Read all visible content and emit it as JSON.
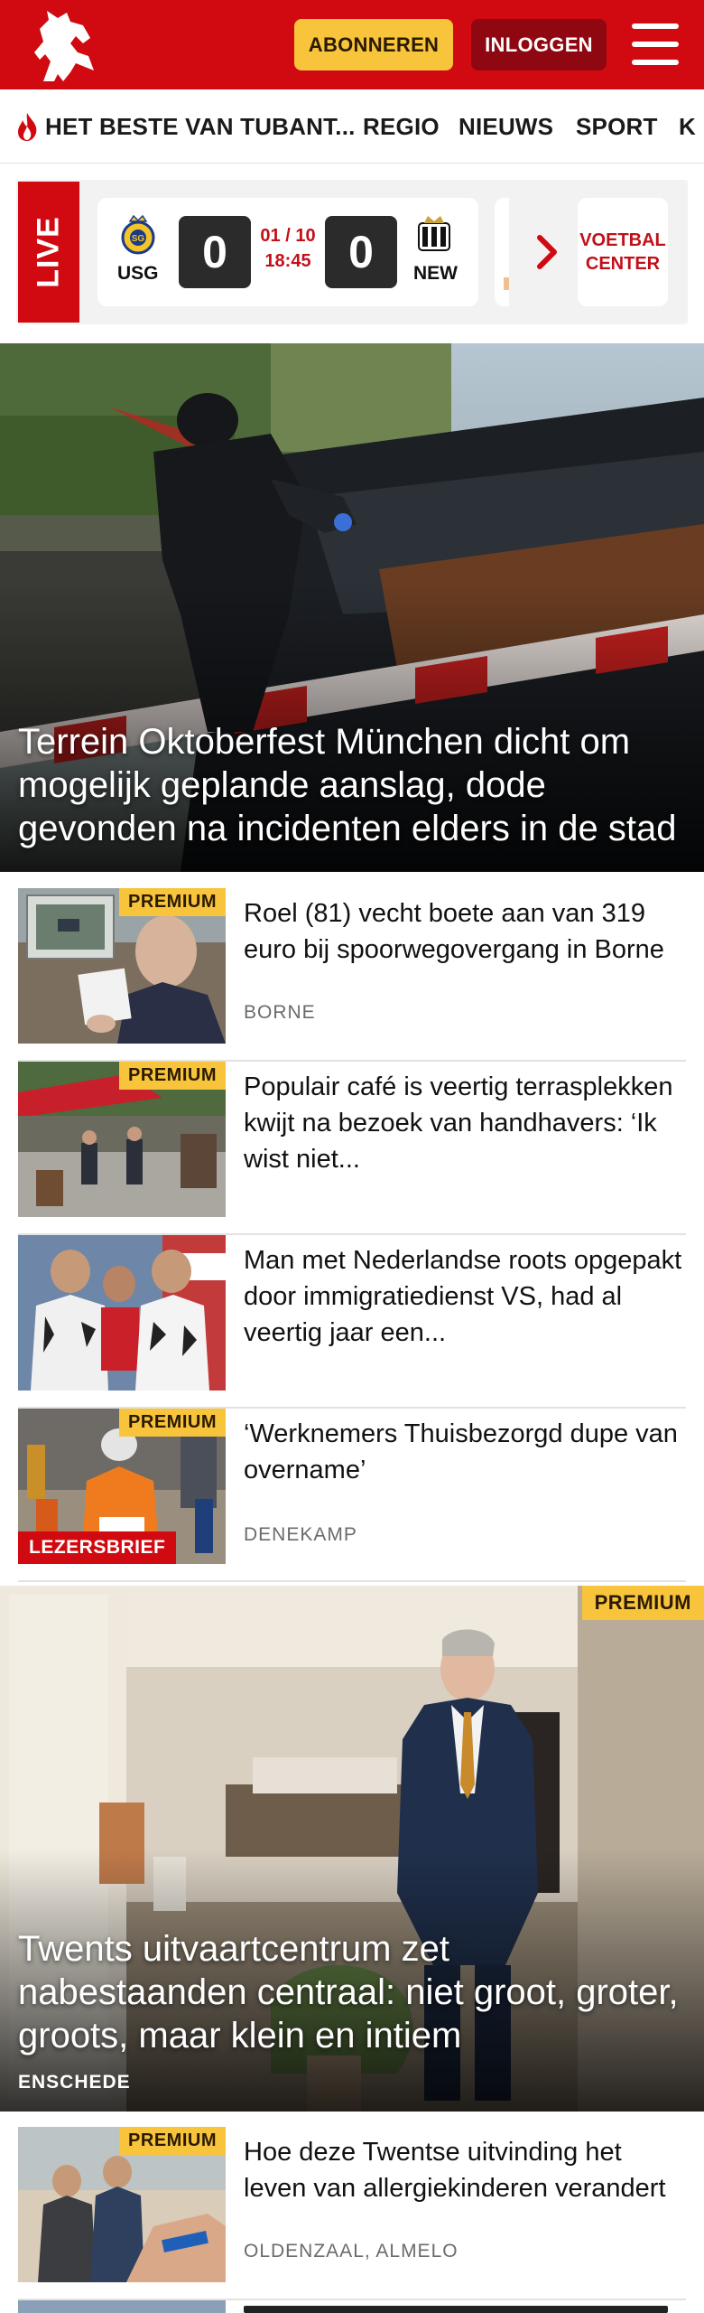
{
  "header": {
    "subscribe_label": "ABONNEREN",
    "login_label": "INLOGGEN"
  },
  "nav": {
    "items": [
      "HET BESTE VAN TUBANT...",
      "REGIO",
      "NIEUWS",
      "SPORT",
      "K"
    ]
  },
  "live": {
    "tag": "LIVE",
    "match": {
      "home": "USG",
      "away": "NEW",
      "home_score": "0",
      "away_score": "0",
      "date": "01 / 10",
      "time": "18:45"
    },
    "center_label": "VOETBAL CENTER"
  },
  "hero": {
    "title": "Terrein Oktoberfest München dicht om mogelijk geplande aanslag, dode gevonden na incidenten elders in de stad"
  },
  "articles": [
    {
      "title": "Roel (81) vecht boete aan van 319 euro bij spoorwegovergang in Borne",
      "meta": "BORNE",
      "badge": "PREMIUM"
    },
    {
      "title": "Populair café is veertig terrasplekken kwijt na bezoek van handhavers: ‘Ik wist niet...",
      "meta": "",
      "badge": "PREMIUM"
    },
    {
      "title": "Man met Nederlandse roots opgepakt door immigratiedienst VS, had al veertig jaar een...",
      "meta": "",
      "badge": ""
    },
    {
      "title": "‘Werknemers Thuisbezorgd dupe van overname’",
      "meta": "DENEKAMP",
      "badge": "PREMIUM",
      "label": "LEZERSBRIEF"
    }
  ],
  "feature": {
    "badge": "PREMIUM",
    "title": "Twents uitvaartcentrum zet nabestaanden centraal: niet groot, groter, groots, maar klein en intiem",
    "meta": "ENSCHEDE"
  },
  "article_last": {
    "title": "Hoe deze Twentse uitvinding het leven van allergiekinderen verandert",
    "meta": "OLDENZAAL, ALMELO",
    "badge": "PREMIUM"
  },
  "colors": {
    "brand_red": "#d10a11",
    "premium_yellow": "#f7c43c",
    "login_dark_red": "#8f0710"
  }
}
